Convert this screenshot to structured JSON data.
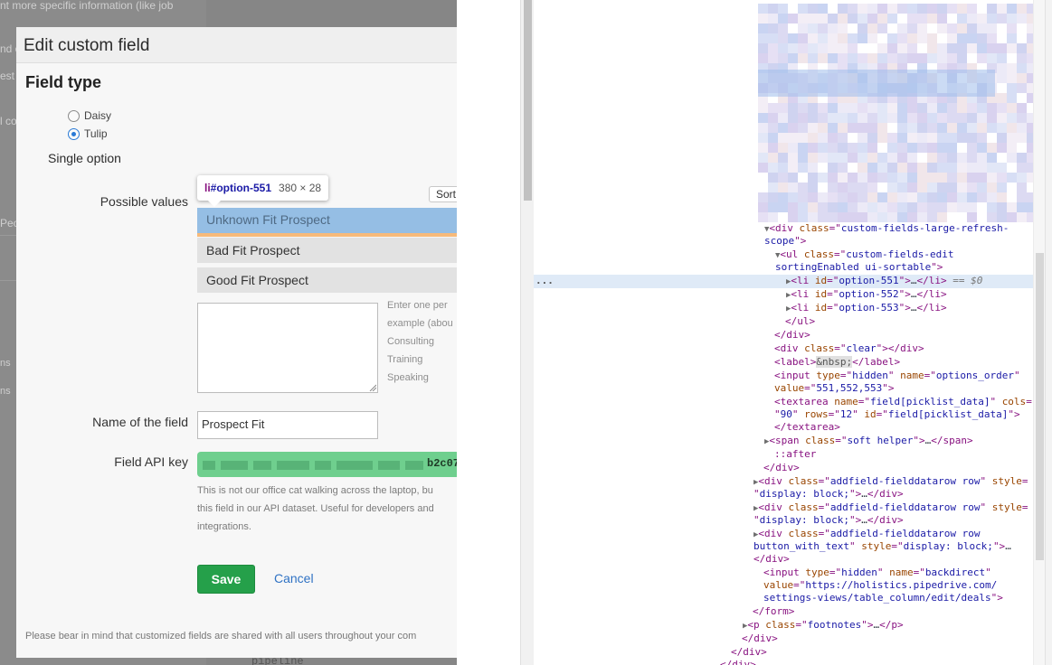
{
  "background": {
    "text_snippets": [
      "nt more specific information (like job",
      "nd c",
      "est",
      "l co",
      "Peo",
      "ns",
      "ns",
      "pipeline"
    ]
  },
  "modal": {
    "title": "Edit custom field",
    "section_title": "Field type",
    "field_types": [
      {
        "label": "Daisy",
        "checked": false
      },
      {
        "label": "Tulip",
        "checked": true
      }
    ],
    "selected_type_heading": "Single option",
    "possible_values_label": "Possible values",
    "sort_button_label": "Sort",
    "values": [
      "Unknown Fit Prospect",
      "Bad Fit Prospect",
      "Good Fit Prospect"
    ],
    "values_hint_lines": [
      "Enter one per",
      "example (abou",
      "Consulting",
      "Training",
      "Speaking"
    ],
    "name_label": "Name of the field",
    "name_value": "Prospect Fit",
    "api_key_label": "Field API key",
    "api_key_visible_tail": "b2c07",
    "api_key_description": [
      "This is not our office cat walking across the laptop, bu",
      "this field in our API dataset. Useful for developers and",
      "integrations."
    ],
    "save_label": "Save",
    "cancel_label": "Cancel",
    "footnote": "Please bear in mind that customized fields are shared with all users throughout your com"
  },
  "inspector_tooltip": {
    "tag": "li",
    "id": "#option-551",
    "dimensions": "380 × 28"
  },
  "devtools": {
    "selected_marker": "== $0",
    "ellipsis": "..."
  },
  "colors": {
    "save_button": "#25a04a",
    "highlight_overlay": "#6fa8dc",
    "tag": "#881280",
    "attribute": "#994500",
    "attribute_value": "#1a1aa6"
  }
}
